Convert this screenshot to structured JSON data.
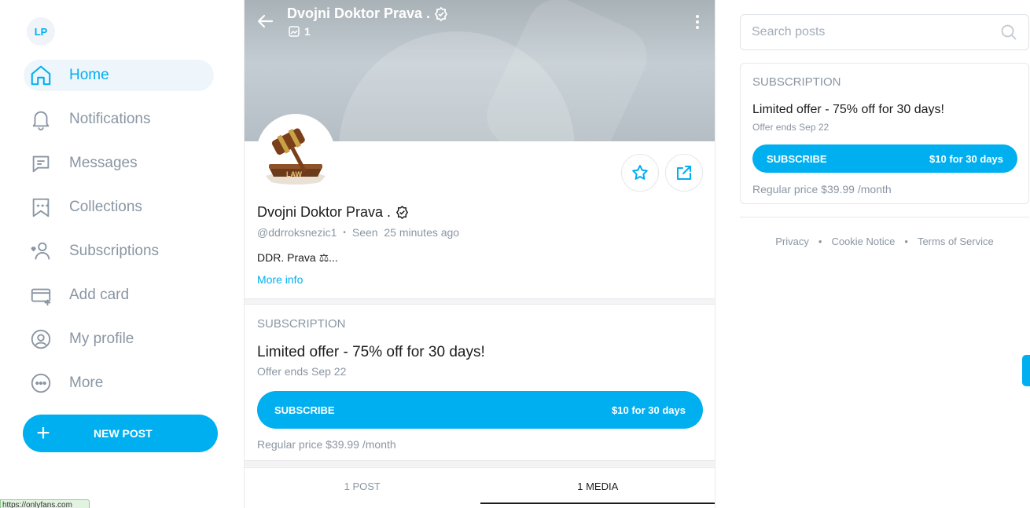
{
  "sidebar": {
    "avatar_initials": "LP",
    "items": [
      {
        "label": "Home",
        "icon": "home-icon",
        "active": true
      },
      {
        "label": "Notifications",
        "icon": "bell-icon"
      },
      {
        "label": "Messages",
        "icon": "message-icon"
      },
      {
        "label": "Collections",
        "icon": "bookmark-stars-icon"
      },
      {
        "label": "Subscriptions",
        "icon": "user-heart-icon"
      },
      {
        "label": "Add card",
        "icon": "credit-card-add-icon"
      },
      {
        "label": "My profile",
        "icon": "user-circle-icon"
      },
      {
        "label": "More",
        "icon": "more-dots-icon"
      }
    ],
    "new_post_label": "NEW POST",
    "status_url": "https://onlyfans.com"
  },
  "header": {
    "title": "Dvojni Doktor Prava .",
    "media_count": "1"
  },
  "profile": {
    "name": "Dvojni Doktor Prava .",
    "handle": "@ddrroksnezic1",
    "seen": "Seen  25 minutes ago",
    "bio": "DDR. Prava ⚖...",
    "more_info": "More info",
    "avatar_text": "LAW"
  },
  "subscription": {
    "title": "SUBSCRIPTION",
    "offer": "Limited offer - 75% off for 30 days!",
    "offer_ends": "Offer ends Sep 22",
    "button_label": "SUBSCRIBE",
    "button_price": "$10 for 30 days",
    "regular_price": "Regular price $39.99 /month"
  },
  "tabs": [
    {
      "label": "1 POST",
      "active": false
    },
    {
      "label": "1 MEDIA",
      "active": true
    }
  ],
  "right": {
    "search_placeholder": "Search posts",
    "footer": [
      "Privacy",
      "Cookie Notice",
      "Terms of Service"
    ]
  },
  "colors": {
    "accent": "#00aff0",
    "muted": "#8a96a3"
  }
}
